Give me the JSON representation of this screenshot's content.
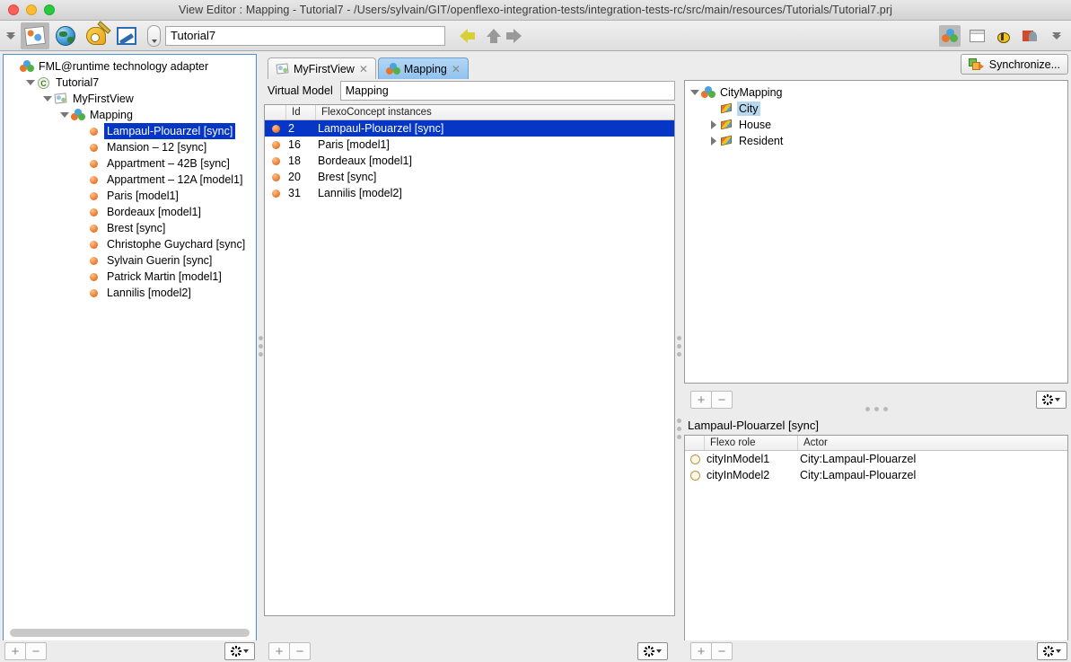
{
  "window": {
    "title": "View Editor : Mapping - Tutorial7 - /Users/sylvain/GIT/openflexo-integration-tests/integration-tests-rc/src/main/resources/Tutorials/Tutorial7.prj",
    "controls": {
      "close": "close-button",
      "minimize": "minimize-button",
      "zoom": "zoom-button"
    }
  },
  "toolbar": {
    "project_field_value": "Tutorial7",
    "icons": [
      {
        "name": "chevrons-down-icon"
      },
      {
        "name": "view-editor-icon"
      },
      {
        "name": "globe-icon"
      },
      {
        "name": "palette-icon"
      },
      {
        "name": "diagram-icon"
      },
      {
        "name": "dropdown-icon"
      }
    ],
    "nav": [
      {
        "name": "back-arrow-icon",
        "color": "#d9cf36"
      },
      {
        "name": "up-arrow-icon",
        "color": "#999999"
      },
      {
        "name": "forward-arrow-icon",
        "color": "#999999"
      }
    ],
    "right_icons": [
      {
        "name": "fml-balls-icon"
      },
      {
        "name": "window-icon"
      },
      {
        "name": "bee-icon"
      },
      {
        "name": "user-icon"
      },
      {
        "name": "chevrons-down-icon"
      }
    ]
  },
  "left_tree": {
    "nodes": [
      {
        "label": "FML@runtime technology adapter",
        "indent": 0,
        "twisty": "none",
        "icon": "fml-balls-icon",
        "selected": false
      },
      {
        "label": "Tutorial7",
        "indent": 1,
        "twisty": "down",
        "icon": "project-icon",
        "selected": false
      },
      {
        "label": "MyFirstView",
        "indent": 2,
        "twisty": "down",
        "icon": "view-icon",
        "selected": false
      },
      {
        "label": "Mapping",
        "indent": 3,
        "twisty": "down",
        "icon": "fml-balls-icon",
        "selected": false
      },
      {
        "label": "Lampaul-Plouarzel [sync]",
        "indent": 4,
        "twisty": "none",
        "icon": "instance-icon",
        "selected": true
      },
      {
        "label": "Mansion – 12 [sync]",
        "indent": 4,
        "twisty": "none",
        "icon": "instance-icon",
        "selected": false
      },
      {
        "label": "Appartment –  42B [sync]",
        "indent": 4,
        "twisty": "none",
        "icon": "instance-icon",
        "selected": false
      },
      {
        "label": "Appartment –  12A [model1]",
        "indent": 4,
        "twisty": "none",
        "icon": "instance-icon",
        "selected": false
      },
      {
        "label": "Paris [model1]",
        "indent": 4,
        "twisty": "none",
        "icon": "instance-icon",
        "selected": false
      },
      {
        "label": "Bordeaux [model1]",
        "indent": 4,
        "twisty": "none",
        "icon": "instance-icon",
        "selected": false
      },
      {
        "label": "Brest [sync]",
        "indent": 4,
        "twisty": "none",
        "icon": "instance-icon",
        "selected": false
      },
      {
        "label": "Christophe Guychard [sync]",
        "indent": 4,
        "twisty": "none",
        "icon": "instance-icon",
        "selected": false
      },
      {
        "label": "Sylvain Guerin [sync]",
        "indent": 4,
        "twisty": "none",
        "icon": "instance-icon",
        "selected": false
      },
      {
        "label": "Patrick Martin [model1]",
        "indent": 4,
        "twisty": "none",
        "icon": "instance-icon",
        "selected": false
      },
      {
        "label": "Lannilis [model2]",
        "indent": 4,
        "twisty": "none",
        "icon": "instance-icon",
        "selected": false
      }
    ]
  },
  "center": {
    "tabs": [
      {
        "label": "MyFirstView",
        "icon": "view-icon",
        "active": false,
        "close": "✕"
      },
      {
        "label": "Mapping",
        "icon": "fml-balls-icon",
        "active": true,
        "close": "✕"
      }
    ],
    "virtual_model_label": "Virtual Model",
    "virtual_model_value": "Mapping",
    "table": {
      "columns": [
        "Id",
        "FlexoConcept instances"
      ],
      "rows": [
        {
          "id": "2",
          "name": "Lampaul-Plouarzel [sync]",
          "selected": true
        },
        {
          "id": "16",
          "name": "Paris [model1]",
          "selected": false
        },
        {
          "id": "18",
          "name": "Bordeaux [model1]",
          "selected": false
        },
        {
          "id": "20",
          "name": "Brest [sync]",
          "selected": false
        },
        {
          "id": "31",
          "name": "Lannilis [model2]",
          "selected": false
        }
      ]
    }
  },
  "right_top": {
    "synchronize_label": "Synchronize...",
    "tree": [
      {
        "label": "CityMapping",
        "indent": 0,
        "twisty": "down",
        "icon": "virtual-model-icon",
        "selected": false
      },
      {
        "label": "City",
        "indent": 1,
        "twisty": "none",
        "icon": "flexo-concept-icon",
        "selected": true
      },
      {
        "label": "House",
        "indent": 1,
        "twisty": "right",
        "icon": "flexo-concept-icon",
        "selected": false
      },
      {
        "label": "Resident",
        "indent": 1,
        "twisty": "right",
        "icon": "flexo-concept-icon",
        "selected": false
      }
    ]
  },
  "right_bottom": {
    "title": "Lampaul-Plouarzel [sync]",
    "table": {
      "columns": [
        "Flexo role",
        "Actor"
      ],
      "rows": [
        {
          "role": "cityInModel1",
          "actor": "City:Lampaul-Plouarzel"
        },
        {
          "role": "cityInModel2",
          "actor": "City:Lampaul-Plouarzel"
        }
      ]
    }
  },
  "bottom_bars": {
    "add_label": "+",
    "remove_label": "−",
    "gear_label": "gear-icon"
  },
  "colors": {
    "selection_blue": "#0636c6",
    "tab_active_blue": "#8fc2ef",
    "panel_bg": "#ececec",
    "instance_orange": "#e8752a"
  }
}
